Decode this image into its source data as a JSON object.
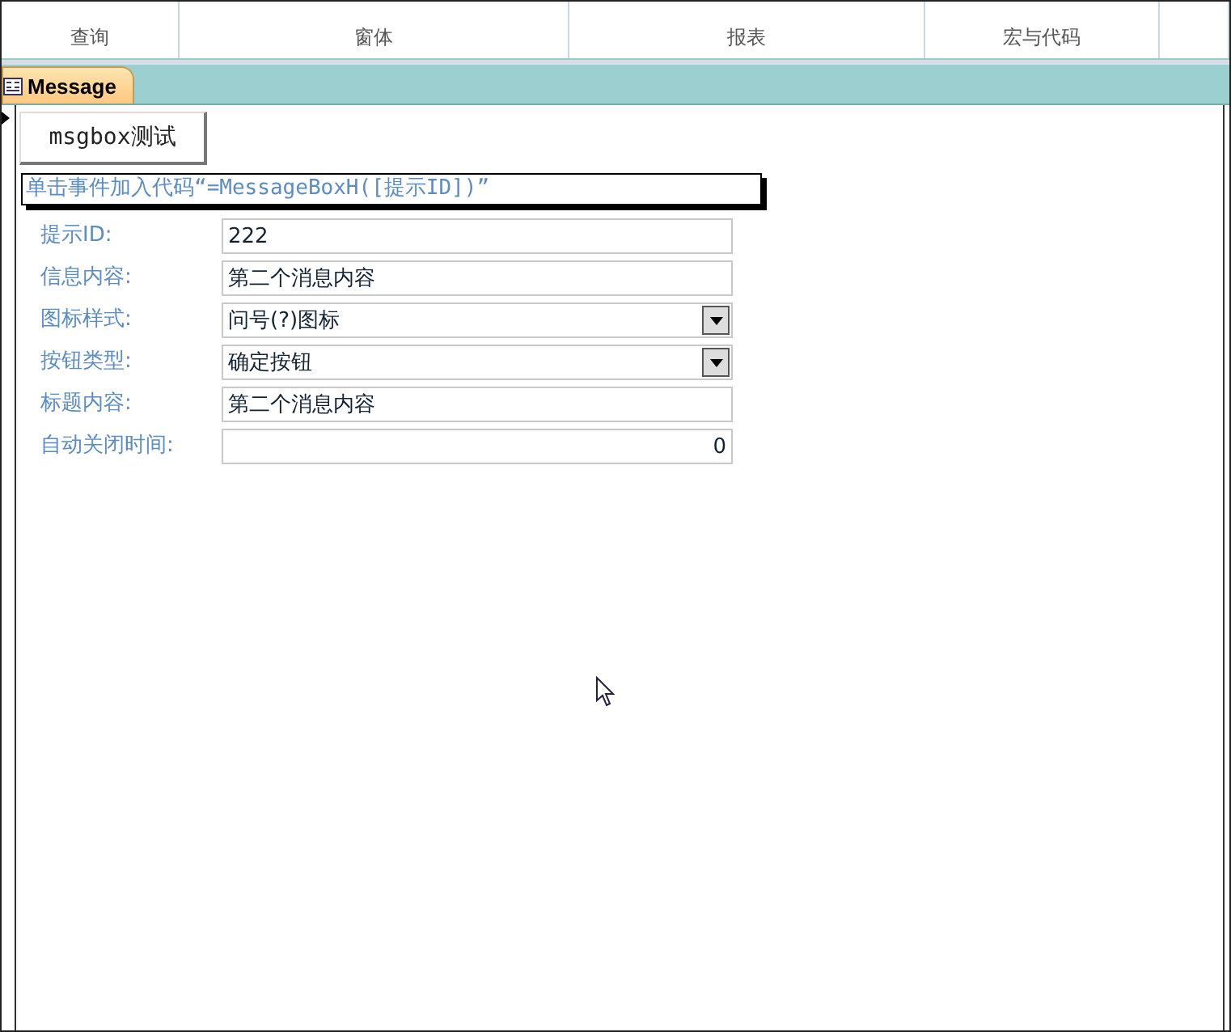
{
  "ribbon_groups": [
    "查询",
    "窗体",
    "报表",
    "宏与代码"
  ],
  "tab": {
    "title": "Message",
    "selected": true
  },
  "button": "msgbox测试",
  "note": "单击事件加入代码“=MessageBoxH([提示ID])”",
  "fields": [
    {
      "label": "提示ID:",
      "value": "222",
      "kind": "text"
    },
    {
      "label": "信息内容:",
      "value": "第二个消息内容",
      "kind": "text"
    },
    {
      "label": "图标样式:",
      "value": "问号(?)图标",
      "kind": "combo"
    },
    {
      "label": "按钮类型:",
      "value": "确定按钮",
      "kind": "combo"
    },
    {
      "label": "标题内容:",
      "value": "第二个消息内容",
      "kind": "text"
    },
    {
      "label": "自动关闭时间:",
      "value": "0",
      "kind": "number"
    }
  ]
}
